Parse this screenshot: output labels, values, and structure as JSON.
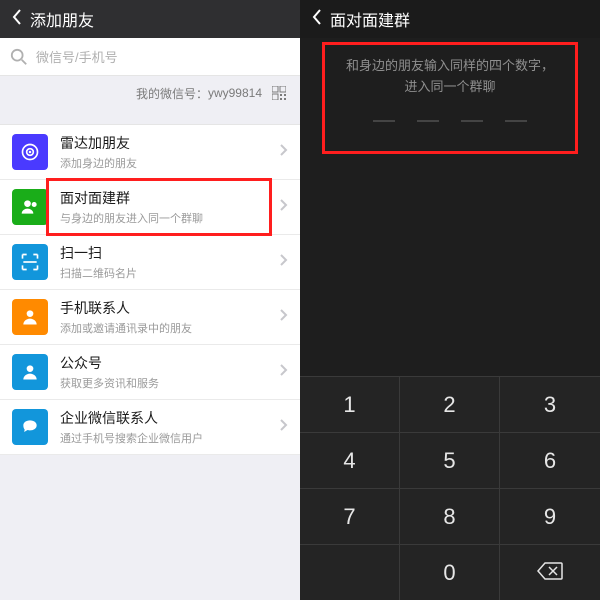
{
  "left": {
    "header_title": "添加朋友",
    "search_placeholder": "微信号/手机号",
    "my_id_prefix": "我的微信号：",
    "my_id_value": "ywy99814",
    "items": [
      {
        "title": "雷达加朋友",
        "subtitle": "添加身边的朋友"
      },
      {
        "title": "面对面建群",
        "subtitle": "与身边的朋友进入同一个群聊"
      },
      {
        "title": "扫一扫",
        "subtitle": "扫描二维码名片"
      },
      {
        "title": "手机联系人",
        "subtitle": "添加或邀请通讯录中的朋友"
      },
      {
        "title": "公众号",
        "subtitle": "获取更多资讯和服务"
      },
      {
        "title": "企业微信联系人",
        "subtitle": "通过手机号搜索企业微信用户"
      }
    ]
  },
  "right": {
    "header_title": "面对面建群",
    "prompt_line1": "和身边的朋友输入同样的四个数字，",
    "prompt_line2": "进入同一个群聊",
    "keys": [
      "1",
      "2",
      "3",
      "4",
      "5",
      "6",
      "7",
      "8",
      "9",
      "",
      "0",
      "←"
    ]
  }
}
